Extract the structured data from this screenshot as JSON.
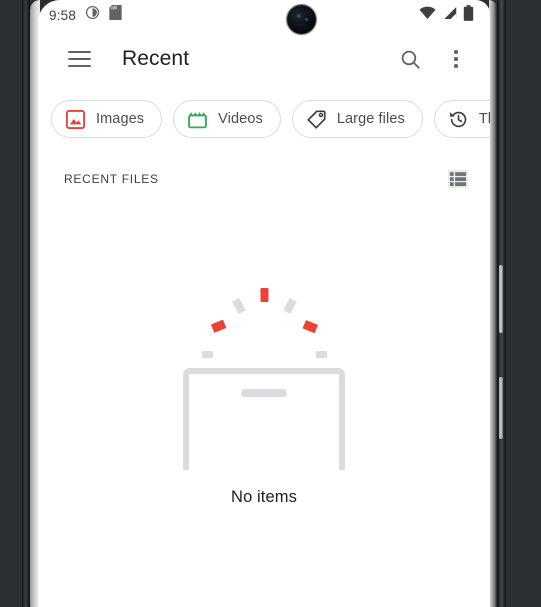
{
  "device": {
    "frame_color": "#2b2e33",
    "screen_bg": "#ffffff"
  },
  "status_bar": {
    "time": "9:58",
    "icons": [
      "clock-icon",
      "sd-card-icon",
      "wifi-icon",
      "cell-signal-icon",
      "battery-icon"
    ]
  },
  "app_bar": {
    "menu_icon": "hamburger-menu-icon",
    "title": "Recent",
    "search_icon": "search-icon",
    "overflow_icon": "more-vert-icon"
  },
  "chips": [
    {
      "label": "Images",
      "icon": "image-icon",
      "color": "#EA4335"
    },
    {
      "label": "Videos",
      "icon": "video-icon",
      "color": "#34A853"
    },
    {
      "label": "Large files",
      "icon": "tag-icon",
      "color": "#3C4043"
    },
    {
      "label": "This",
      "icon": "history-icon",
      "color": "#3C4043"
    }
  ],
  "section": {
    "title": "RECENT FILES",
    "view_toggle_icon": "list-view-icon"
  },
  "empty_state": {
    "illustration": "empty-box-with-confetti-illustration",
    "message": "No items",
    "confetti_red": "#EA4335",
    "confetti_gray": "#DADCE0",
    "box_outline": "#DADCE0"
  }
}
